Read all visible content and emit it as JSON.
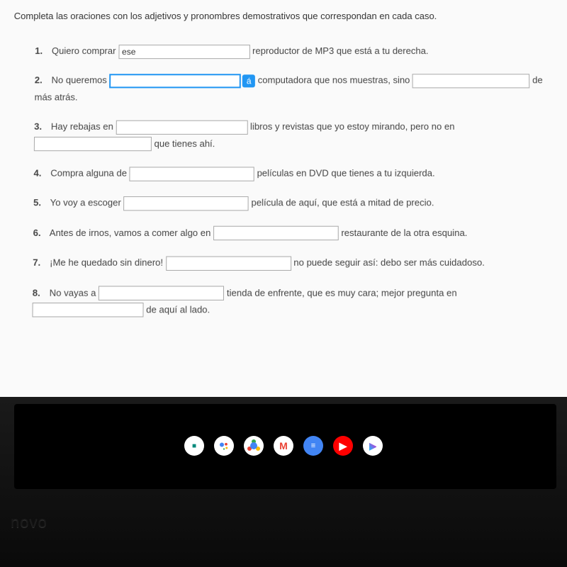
{
  "instructions": "Completa las oraciones con los adjetivos y pronombres demostrativos que correspondan en cada caso.",
  "accent_char": "á",
  "questions": [
    {
      "num": "1.",
      "parts": [
        {
          "type": "text",
          "value": "Quiero comprar "
        },
        {
          "type": "blank",
          "value": "ese",
          "class": "w1"
        },
        {
          "type": "text",
          "value": " reproductor de MP3 que está a tu derecha."
        }
      ]
    },
    {
      "num": "2.",
      "parts": [
        {
          "type": "text",
          "value": "No queremos "
        },
        {
          "type": "blank",
          "value": "",
          "class": "w1 active"
        },
        {
          "type": "accent"
        },
        {
          "type": "text",
          "value": " computadora que nos muestras, sino "
        },
        {
          "type": "blank",
          "value": "",
          "class": "w3"
        },
        {
          "type": "text",
          "value": " de más atrás."
        }
      ]
    },
    {
      "num": "3.",
      "parts": [
        {
          "type": "text",
          "value": "Hay rebajas en "
        },
        {
          "type": "blank",
          "value": "",
          "class": "w1"
        },
        {
          "type": "text",
          "value": " libros y revistas que yo estoy mirando, pero no en "
        },
        {
          "type": "break"
        },
        {
          "type": "blank",
          "value": "",
          "class": "w3"
        },
        {
          "type": "text",
          "value": " que tienes ahí."
        }
      ]
    },
    {
      "num": "4.",
      "parts": [
        {
          "type": "text",
          "value": "Compra alguna de "
        },
        {
          "type": "blank",
          "value": "",
          "class": "w2"
        },
        {
          "type": "text",
          "value": " películas en DVD que tienes a tu izquierda."
        }
      ]
    },
    {
      "num": "5.",
      "parts": [
        {
          "type": "text",
          "value": "Yo voy a escoger "
        },
        {
          "type": "blank",
          "value": "",
          "class": "w2"
        },
        {
          "type": "text",
          "value": " película de aquí, que está a mitad de precio."
        }
      ]
    },
    {
      "num": "6.",
      "parts": [
        {
          "type": "text",
          "value": "Antes de irnos, vamos a comer algo en "
        },
        {
          "type": "blank",
          "value": "",
          "class": "w2"
        },
        {
          "type": "text",
          "value": " restaurante de la otra esquina."
        }
      ]
    },
    {
      "num": "7.",
      "parts": [
        {
          "type": "text",
          "value": "¡Me he quedado sin dinero! "
        },
        {
          "type": "blank",
          "value": "",
          "class": "w2"
        },
        {
          "type": "text",
          "value": " no puede seguir así: debo ser más cuidadoso."
        }
      ]
    },
    {
      "num": "8.",
      "parts": [
        {
          "type": "text",
          "value": "No vayas a "
        },
        {
          "type": "blank",
          "value": "",
          "class": "w2"
        },
        {
          "type": "text",
          "value": " tienda de enfrente, que es muy cara; mejor pregunta en "
        },
        {
          "type": "break"
        },
        {
          "type": "blank",
          "value": "",
          "class": "w4"
        },
        {
          "type": "text",
          "value": " de aquí al lado."
        }
      ]
    }
  ],
  "laptop_brand": "novo",
  "taskbar_icons": [
    {
      "name": "meet-icon",
      "label": "📹"
    },
    {
      "name": "assistant-icon",
      "label": ""
    },
    {
      "name": "chrome-icon",
      "label": ""
    },
    {
      "name": "gmail-icon",
      "label": "M"
    },
    {
      "name": "docs-icon",
      "label": "≡"
    },
    {
      "name": "youtube-icon",
      "label": "▶"
    },
    {
      "name": "play-store-icon",
      "label": ""
    }
  ]
}
